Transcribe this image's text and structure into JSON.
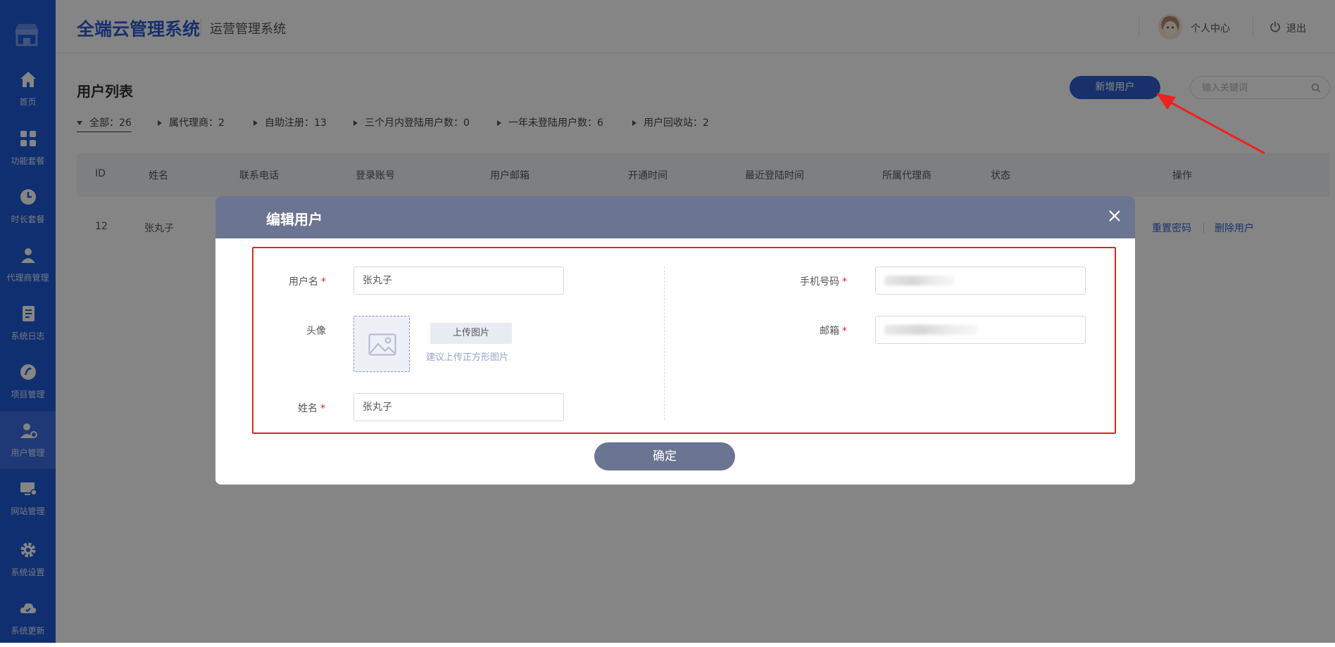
{
  "sidebar": {
    "items": [
      {
        "label": "首页",
        "icon": "home-icon"
      },
      {
        "label": "功能套餐",
        "icon": "grid-icon"
      },
      {
        "label": "时长套餐",
        "icon": "clock-icon"
      },
      {
        "label": "代理商管理",
        "icon": "agent-icon"
      },
      {
        "label": "系统日志",
        "icon": "log-icon"
      },
      {
        "label": "项目管理",
        "icon": "project-icon"
      },
      {
        "label": "用户管理",
        "icon": "user-manage-icon"
      },
      {
        "label": "网站管理",
        "icon": "website-icon"
      },
      {
        "label": "系统设置",
        "icon": "gear-icon"
      },
      {
        "label": "系统更新",
        "icon": "cloud-update-icon"
      }
    ],
    "active_index": 6
  },
  "header": {
    "brand": "全端云管理系统",
    "sub_brand": "运营管理系统",
    "personal_center": "个人中心",
    "logout": "退出"
  },
  "main": {
    "title": "用户列表",
    "add_user": "新增用户",
    "search_placeholder": "输入关键词",
    "filters": [
      "全部：26",
      "属代理商：2",
      "自助注册：13",
      "三个月内登陆用户数：0",
      "一年未登陆用户数：6",
      "用户回收站：2"
    ],
    "table": {
      "columns": [
        "ID",
        "姓名",
        "联系电话",
        "登录账号",
        "用户邮箱",
        "开通时间",
        "最近登陆时间",
        "所属代理商",
        "状态",
        "操作"
      ],
      "rows": [
        {
          "id": "12",
          "name": "张丸子",
          "reset": "重置密码",
          "delete": "删除用户"
        }
      ]
    }
  },
  "modal": {
    "title": "编辑用户",
    "username_label": "用户名",
    "username_value": "张丸子",
    "avatar_label": "头像",
    "upload_label": "上传图片",
    "upload_hint": "建议上传正方形图片",
    "realname_label": "姓名",
    "realname_value": "张丸子",
    "phone_label": "手机号码",
    "email_label": "邮箱",
    "required_mark": "*",
    "confirm": "确定"
  },
  "colors": {
    "primary": "#2f5fd0",
    "sidebar": "#1f5ad6",
    "modal_header": "#6b7491",
    "required": "#e02424"
  }
}
